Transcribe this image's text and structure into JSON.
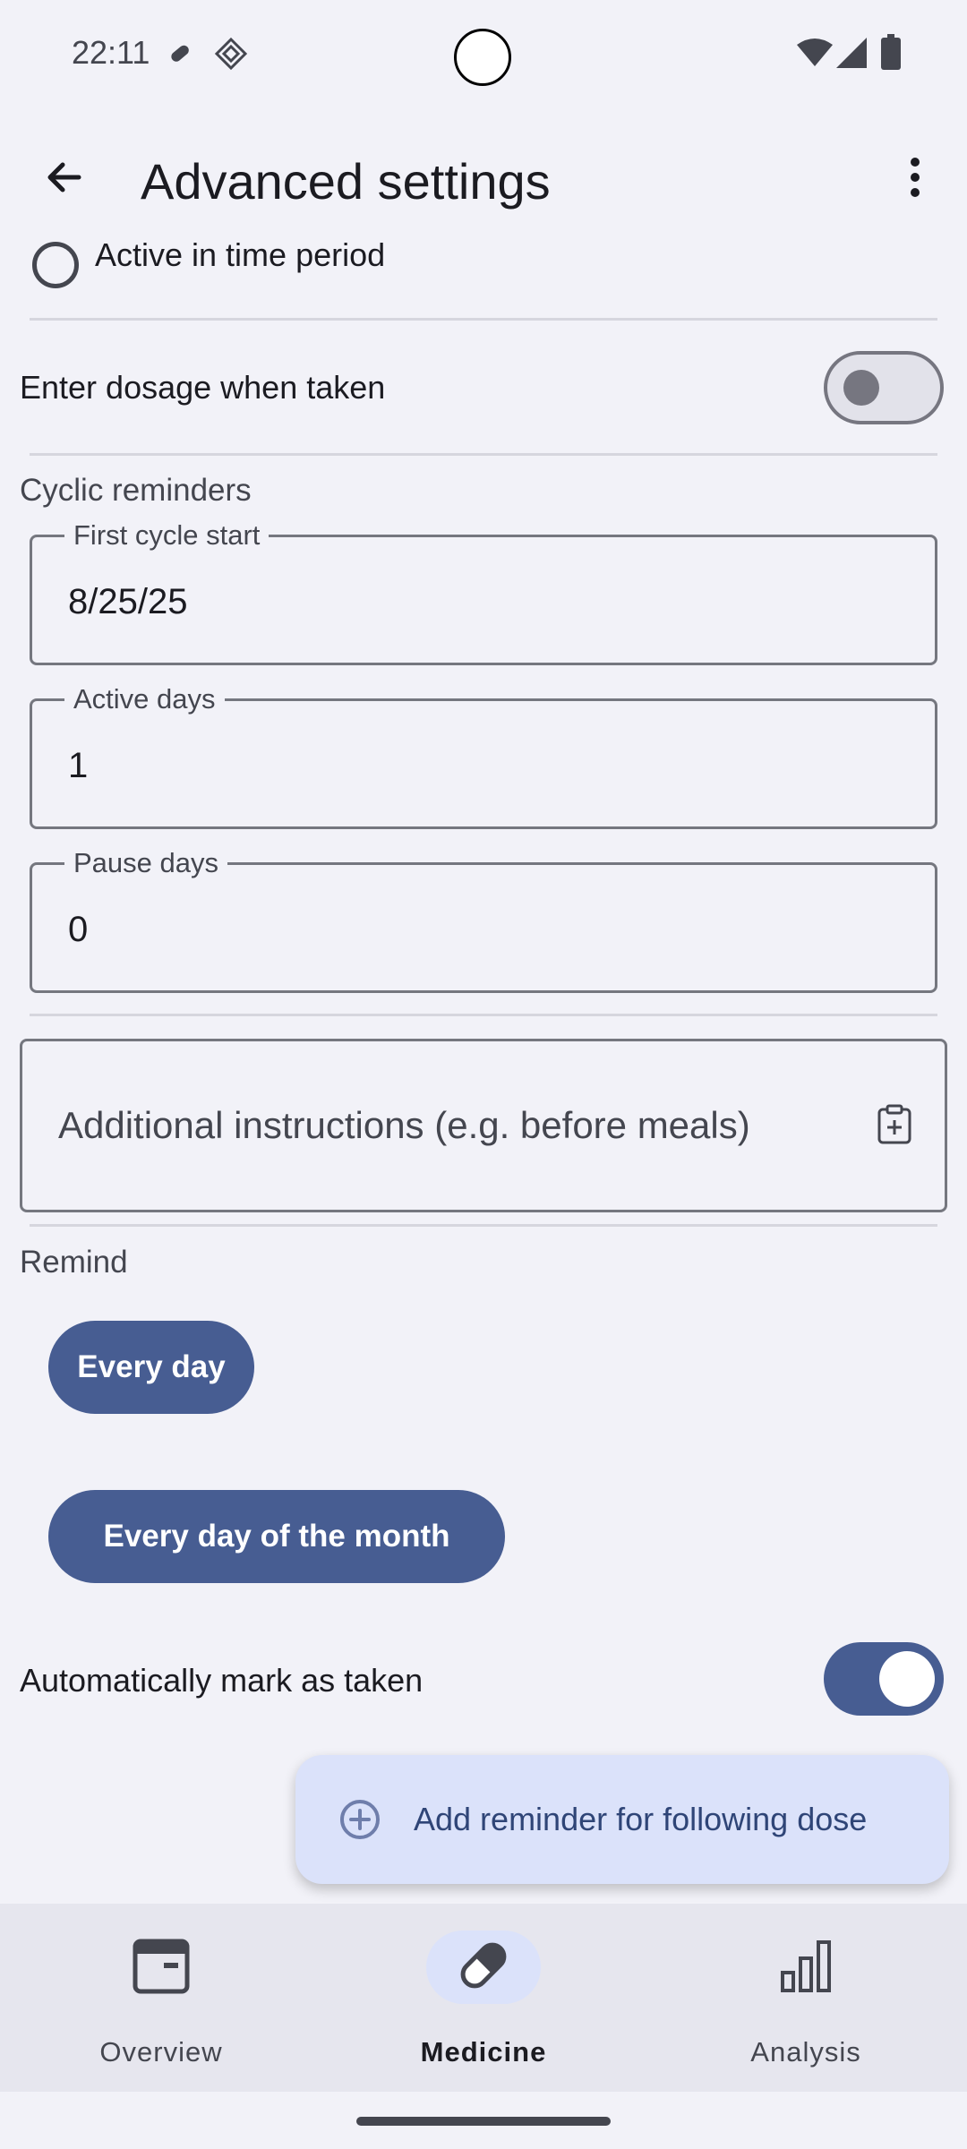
{
  "status_bar": {
    "time": "22:11",
    "icons": [
      "pill-icon",
      "app-icon",
      "wifi-icon",
      "signal-icon",
      "battery-icon"
    ]
  },
  "app_bar": {
    "title": "Advanced settings",
    "back_icon": "arrow-back-icon",
    "more_icon": "more-vert-icon"
  },
  "content": {
    "partial_radio_label": "Active in time period",
    "dosage_toggle": {
      "label": "Enter dosage when taken",
      "on": false
    },
    "cyclic": {
      "section_label": "Cyclic reminders",
      "first_cycle_start": {
        "label": "First cycle start",
        "value": "8/25/25"
      },
      "active_days": {
        "label": "Active days",
        "value": "1"
      },
      "pause_days": {
        "label": "Pause days",
        "value": "0"
      }
    },
    "instructions": {
      "placeholder": "Additional instructions (e.g. before meals)",
      "icon": "clipboard-add-icon"
    },
    "remind": {
      "section_label": "Remind",
      "chips": [
        "Every day",
        "Every day of the month"
      ]
    },
    "auto_mark_toggle": {
      "label": "Automatically mark as taken",
      "on": true
    },
    "fab": {
      "label": "Add reminder for following dose",
      "icon": "add-circle-icon"
    }
  },
  "nav": {
    "items": [
      {
        "label": "Overview",
        "icon": "calendar-icon",
        "active": false
      },
      {
        "label": "Medicine",
        "icon": "pill-icon",
        "active": true
      },
      {
        "label": "Analysis",
        "icon": "bar-chart-icon",
        "active": false
      }
    ]
  },
  "colors": {
    "primary": "#475d92",
    "primary_container": "#dbe2fa",
    "background": "#f2f2f8",
    "nav_background": "#e6e6ee"
  }
}
